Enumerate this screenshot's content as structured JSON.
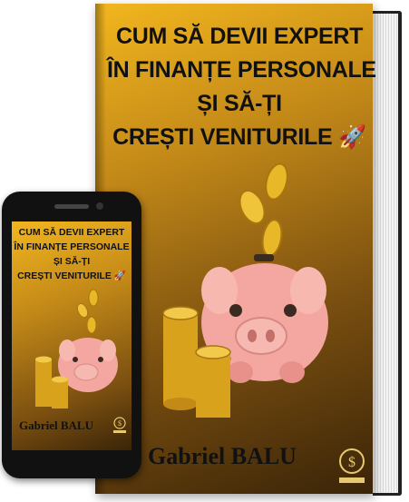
{
  "book": {
    "title_lines": [
      "CUM SĂ DEVII EXPERT",
      "ÎN FINANȚE PERSONALE",
      "ȘI SĂ-ȚI",
      "CREȘTI VENITURILE"
    ],
    "author": "Gabriel BALU",
    "title_emoji_icon": "rocket-icon",
    "illustration": "piggy-bank-with-coins"
  },
  "phone": {
    "title_lines": [
      "CUM SĂ DEVII EXPERT",
      "ÎN FINANȚE PERSONALE",
      "ȘI SĂ-ȚI",
      "CREȘTI VENITURILE"
    ],
    "author": "Gabriel BALU"
  },
  "colors": {
    "cover_gold": "#f2b61e",
    "cover_dark": "#3a2408",
    "piggy_pink": "#f4a7a0",
    "coin_gold": "#e8b828"
  }
}
